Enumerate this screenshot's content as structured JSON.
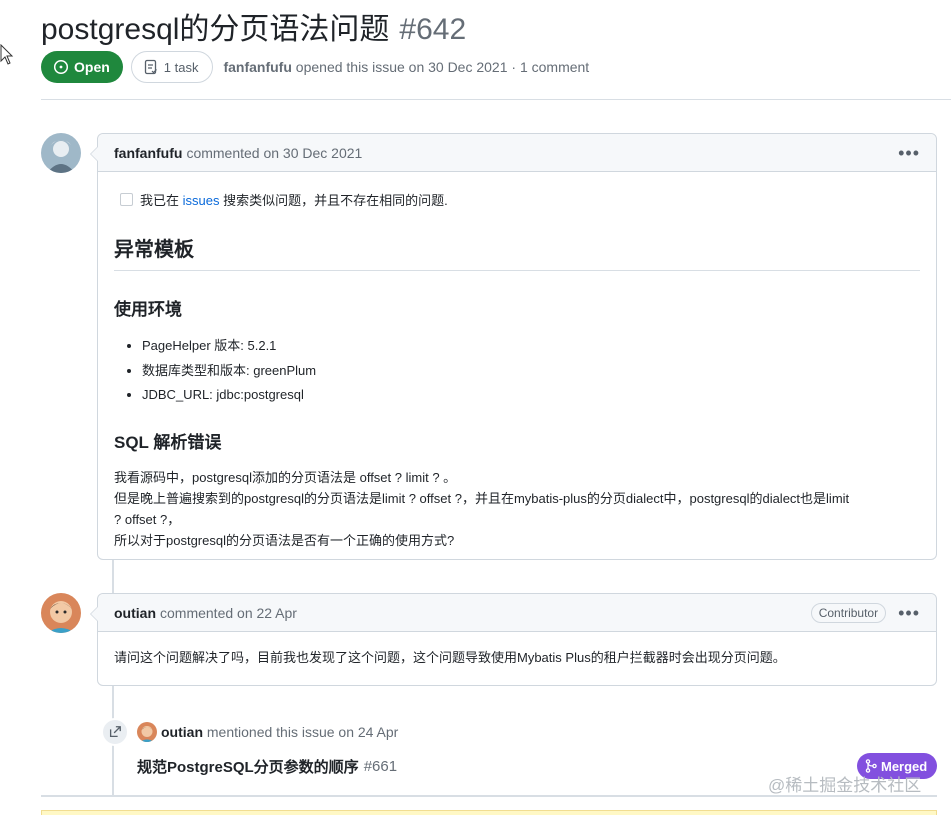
{
  "issue": {
    "title": "postgresql的分页语法问题",
    "number": "#642",
    "state": "Open",
    "tasks": "1 task",
    "author": "fanfanfufu",
    "opened_text": "opened this issue on 30 Dec 2021 · 1 comment"
  },
  "comment1": {
    "author": "fanfanfufu",
    "meta": "commented on 30 Dec 2021",
    "task_before": "我已在",
    "task_link": "issues",
    "task_after": "搜索类似问题，并且不存在相同的问题.",
    "h1": "异常模板",
    "h2_env": "使用环境",
    "env_items": [
      "PageHelper 版本: 5.2.1",
      "数据库类型和版本: greenPlum",
      "JDBC_URL: jdbc:postgresql"
    ],
    "h2_sql": "SQL 解析错误",
    "para_lines": [
      "我看源码中，postgresql添加的分页语法是 offset ? limit ? 。",
      "但是晚上普遍搜索到的postgresql的分页语法是limit ? offset ?，并且在mybatis-plus的分页dialect中，postgresql的dialect也是limit",
      "?   offset ?，",
      "所以对于postgresql的分页语法是否有一个正确的使用方式?"
    ]
  },
  "comment2": {
    "author": "outian",
    "meta": "commented on 22 Apr",
    "role": "Contributor",
    "body": "请问这个问题解决了吗，目前我也发现了这个问题，这个问题导致使用Mybatis Plus的租户拦截器时会出现分页问题。"
  },
  "mention": {
    "author": "outian",
    "text": "mentioned this issue on 24 Apr",
    "ref_title": "规范PostgreSQL分页参数的顺序",
    "ref_number": "#661",
    "ref_state": "Merged"
  },
  "watermark": "@稀土掘金技术社区",
  "colors": {
    "open_green": "#1f883d",
    "merged_purple": "#8250df",
    "link_blue": "#0969da"
  }
}
